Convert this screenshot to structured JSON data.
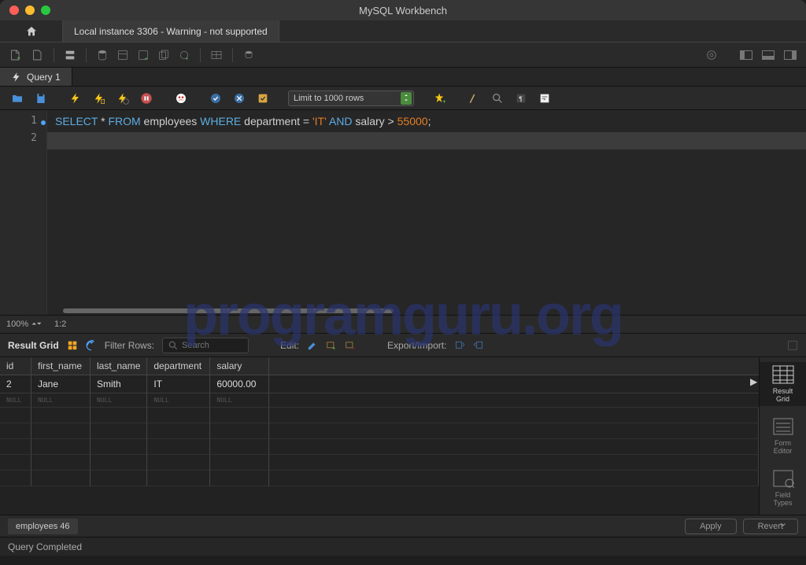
{
  "title": "MySQL Workbench",
  "connection_tab": "Local instance 3306 - Warning - not supported",
  "query_tab": "Query 1",
  "limit_dropdown": "Limit to 1000 rows",
  "editor": {
    "line1": {
      "kw_select": "SELECT",
      "star": " * ",
      "kw_from": "FROM",
      "tbl": " employees ",
      "kw_where": "WHERE",
      "col1": " department = ",
      "str": "'IT'",
      "sp": " ",
      "kw_and": "AND",
      "col2": " salary > ",
      "num": "55000",
      "semi": ";"
    }
  },
  "zoom": "100%",
  "cursor_pos": "1:2",
  "result_grid_label": "Result Grid",
  "filter_label": "Filter Rows:",
  "filter_placeholder": "Search",
  "edit_label": "Edit:",
  "export_label": "Export/Import:",
  "columns": [
    "id",
    "first_name",
    "last_name",
    "department",
    "salary"
  ],
  "rows": [
    {
      "id": "2",
      "first_name": "Jane",
      "last_name": "Smith",
      "department": "IT",
      "salary": "60000.00"
    }
  ],
  "null_label": "NULL",
  "side": {
    "grid": "Result\nGrid",
    "form": "Form\nEditor",
    "field": "Field\nTypes"
  },
  "result_tab": "employees 46",
  "apply": "Apply",
  "revert": "Revert",
  "status": "Query Completed",
  "watermark": "programguru.org"
}
